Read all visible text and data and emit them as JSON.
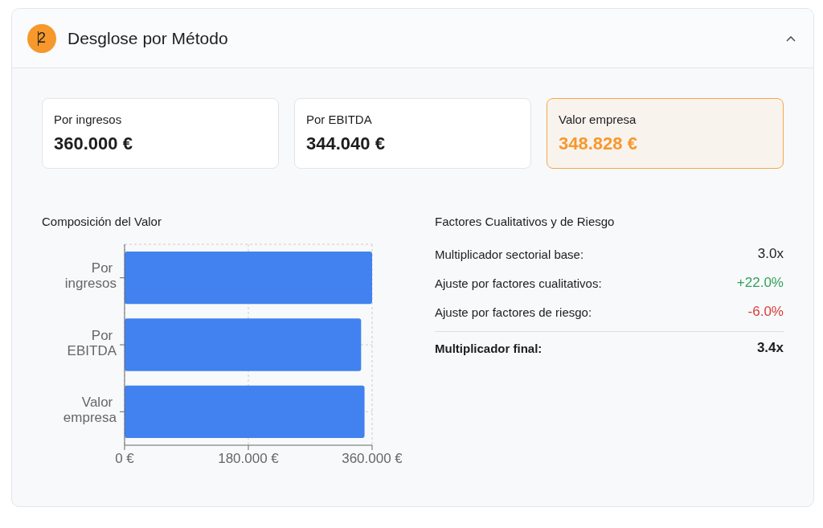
{
  "panel": {
    "badge": "2",
    "title": "Desglose por Método",
    "expanded": true
  },
  "metrics": [
    {
      "label": "Por ingresos",
      "value": "360.000 €",
      "selected": false
    },
    {
      "label": "Por EBITDA",
      "value": "344.040 €",
      "selected": false
    },
    {
      "label": "Valor empresa",
      "value": "348.828 €",
      "selected": true
    }
  ],
  "composition": {
    "title": "Composición del Valor",
    "chart_data": {
      "type": "bar",
      "orientation": "horizontal",
      "categories": [
        "Por ingresos",
        "Por EBITDA",
        "Valor empresa"
      ],
      "values": [
        360,
        344,
        349
      ],
      "color": "#4182f0",
      "xlim": [
        0,
        360
      ],
      "xticks": [
        {
          "value": 0,
          "label": "0 €"
        },
        {
          "value": 180,
          "label": "180.000 €"
        },
        {
          "value": 360,
          "label": "360.000 €"
        }
      ]
    }
  },
  "factors": {
    "title": "Factores Cualitativos y de Riesgo",
    "rows": [
      {
        "label": "Multiplicador sectorial base:",
        "value": "3.0x",
        "kind": "neutral"
      },
      {
        "label": "Ajuste por factores cualitativos:",
        "value": "+22.0%",
        "kind": "positive"
      },
      {
        "label": "Ajuste por factores de riesgo:",
        "value": "-6.0%",
        "kind": "negative"
      },
      {
        "label": "Multiplicador final:",
        "value": "3.4x",
        "kind": "total"
      }
    ]
  }
}
